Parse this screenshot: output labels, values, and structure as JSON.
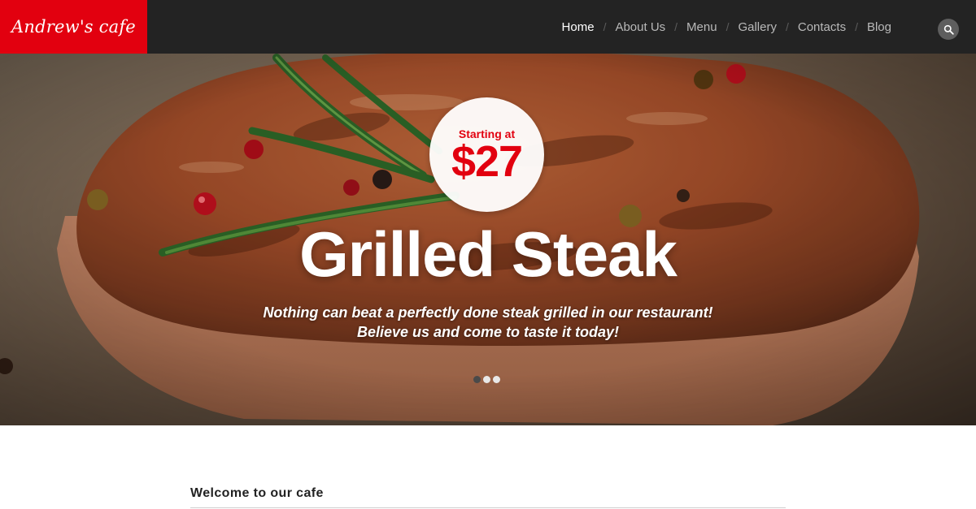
{
  "header": {
    "logo_text": "Andrew's cafe",
    "nav": [
      {
        "label": "Home",
        "active": true
      },
      {
        "label": "About Us",
        "active": false
      },
      {
        "label": "Menu",
        "active": false
      },
      {
        "label": "Gallery",
        "active": false
      },
      {
        "label": "Contacts",
        "active": false
      },
      {
        "label": "Blog",
        "active": false
      }
    ],
    "nav_separator": "/",
    "search_icon": "search-icon"
  },
  "hero": {
    "badge_top": "Starting at",
    "badge_price": "$27",
    "title": "Grilled Steak",
    "subtitle": "Nothing can beat a perfectly done steak grilled in our restaurant! Believe us and come to taste it today!",
    "slides_total": 3,
    "slide_active_index": 0
  },
  "content": {
    "heading": "Welcome to our cafe"
  },
  "colors": {
    "brand_red": "#e2000f",
    "header_bg": "#232323"
  }
}
